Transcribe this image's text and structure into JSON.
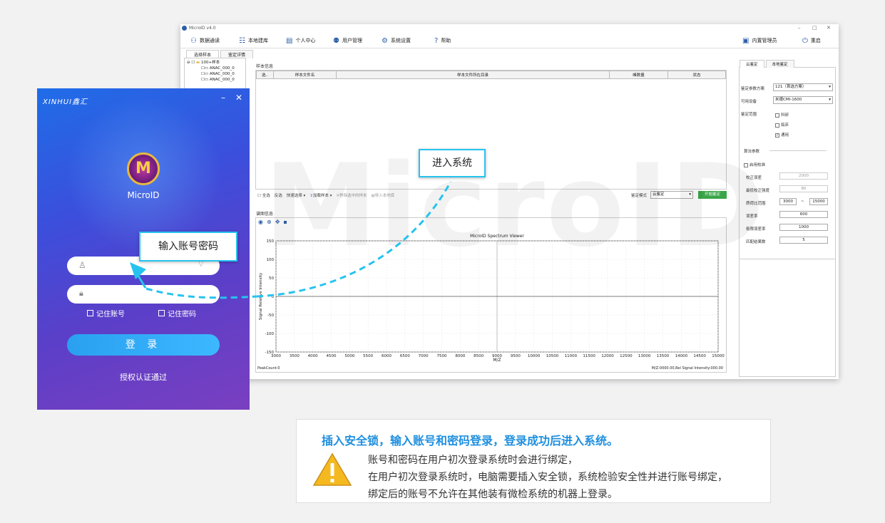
{
  "window": {
    "title": "MicroID v4.0",
    "menu": [
      "数据通读",
      "本地建库",
      "个人中心",
      "用户管理",
      "系统设置",
      "帮助"
    ],
    "admin_label": "内置管理员",
    "restart_label": "重启",
    "subtabs": [
      "选择样本",
      "鉴定详情"
    ],
    "tree": [
      "100+样本",
      "ANAC_000_0",
      "ANAC_000_0",
      "ANAC_000_0"
    ],
    "sample_group_title": "样本信息",
    "sample_cols": [
      "选..",
      "样本文件名",
      "样本文件所在目录",
      "峰数量",
      "状态"
    ],
    "toolbar": {
      "select_all": "全选",
      "invert": "反选",
      "quick_select": "快速选择",
      "load_sample": "加载样本",
      "remove_selected": "移除选中的样本",
      "import_local": "导入本地库",
      "mode_label": "鉴定模式",
      "mode_value": "云鉴定",
      "start_btn": "开始鉴定"
    },
    "spectrum_group_title": "谱图信息",
    "right_tabs": [
      "云鉴定",
      "本地鉴定"
    ],
    "right": {
      "scheme_label": "鉴定参数方案",
      "scheme_value": "121（首选方案）",
      "device_label": "可用设备",
      "device_value": "米德CMI-1600",
      "range_label": "鉴定范围",
      "range_opts": [
        {
          "label": "科研",
          "checked": false
        },
        {
          "label": "临床",
          "checked": false
        },
        {
          "label": "通用",
          "checked": true
        }
      ],
      "algo_title": "算法参数",
      "enable_calib": "启用校准",
      "calib_err_label": "校正误差",
      "calib_err_value": "2000",
      "min_calib_label": "最低校正强度",
      "min_calib_value": "80",
      "mass_range_label": "质荷比范围",
      "mass_min": "3000",
      "mass_sep": "~",
      "mass_max": "15000",
      "tol_label": "误差率",
      "tol_value": "600",
      "limit_label": "极限误差率",
      "limit_value": "1000",
      "match_label": "匹配结果数",
      "match_value": "5"
    }
  },
  "chart_data": {
    "type": "line",
    "title": "MicroID Spectrum Viewer",
    "xlabel": "M/Z",
    "ylabel": "Signal Relative Intensity",
    "xlim": [
      3000,
      15000
    ],
    "ylim": [
      -150,
      150
    ],
    "xticks": [
      "3000",
      "3500",
      "4000",
      "4500",
      "5000",
      "5500",
      "6000",
      "6500",
      "7000",
      "7500",
      "8000",
      "8500",
      "9000",
      "9500",
      "10000",
      "10500",
      "11000",
      "11500",
      "12000",
      "12500",
      "13000",
      "13500",
      "14000",
      "14500",
      "15000"
    ],
    "yticks": [
      "150",
      "100",
      "50",
      "0",
      "-50",
      "-100",
      "-150"
    ],
    "x": [
      3000,
      15000
    ],
    "y": [
      0,
      0
    ],
    "grid": true,
    "footer_left": "PeakCount:0",
    "footer_right": "M/Z:0000.00,Rel Signal Intensity:000.00"
  },
  "watermark": "MicroID",
  "login": {
    "brand": "XINHUI鑫汇",
    "logo_text": "MicroID",
    "remember_account": "记住账号",
    "remember_password": "记住密码",
    "login_btn": "登 录",
    "auth_status": "授权认证通过"
  },
  "callouts": {
    "enter_system": "进入系统",
    "enter_credentials": "输入账号密码"
  },
  "colors": {
    "accent": "#27c3ee",
    "start_btn": "#3aa648",
    "note_head": "#1e8fe0"
  },
  "note": {
    "heading": "插入安全锁，输入账号和密码登录，登录成功后进入系统。",
    "lines": [
      "账号和密码在用户初次登录系统时会进行绑定，",
      "在用户初次登录系统时，电脑需要插入安全锁，系统检验安全性并进行账号绑定，",
      "绑定后的账号不允许在其他装有微检系统的机器上登录。"
    ]
  }
}
